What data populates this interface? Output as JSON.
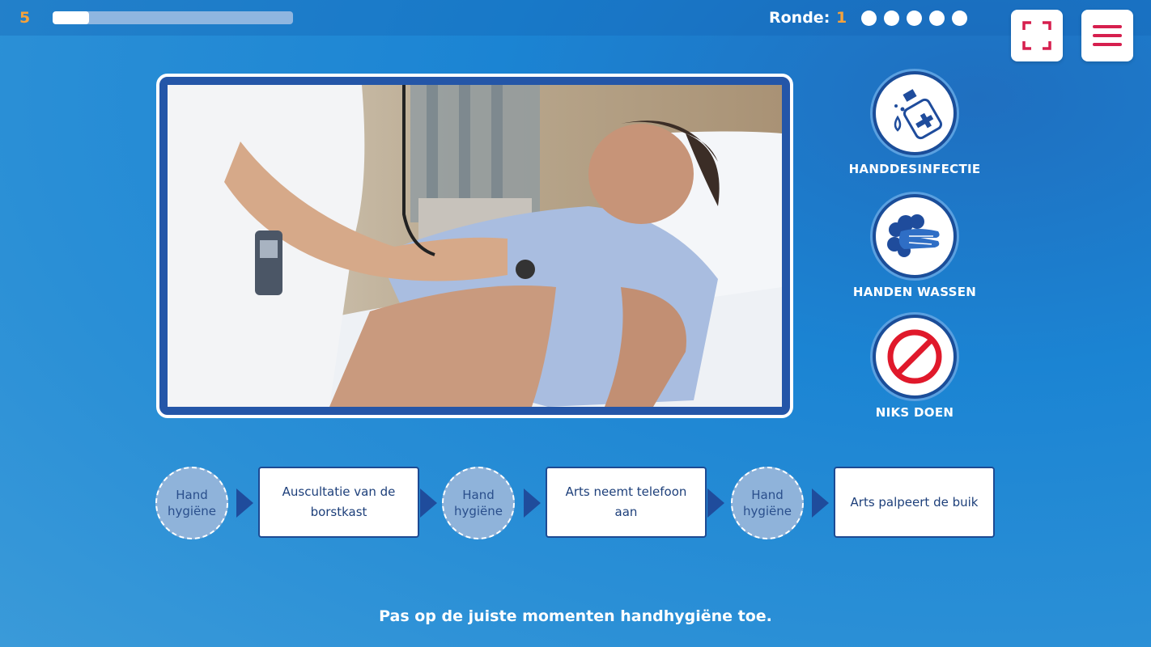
{
  "header": {
    "score": "5",
    "progress_fraction": 0.15,
    "round_label": "Ronde:",
    "round_number": "1",
    "round_dots": 5
  },
  "buttons": {
    "fullscreen_icon": "fullscreen-icon",
    "menu_icon": "hamburger-menu-icon"
  },
  "choices": [
    {
      "label": "HANDDESINFECTIE",
      "icon": "hand-sanitizer-icon"
    },
    {
      "label": "HANDEN WASSEN",
      "icon": "hand-washing-icon"
    },
    {
      "label": "NIKS DOEN",
      "icon": "prohibited-icon"
    }
  ],
  "sequence": [
    {
      "type": "slot",
      "text": "Hand hygiëne"
    },
    {
      "type": "step",
      "text": "Auscultatie van de borstkast"
    },
    {
      "type": "slot",
      "text": "Hand hygiëne"
    },
    {
      "type": "step",
      "text": "Arts neemt telefoon aan"
    },
    {
      "type": "slot",
      "text": "Hand hygiëne"
    },
    {
      "type": "step",
      "text": "Arts palpeert de buik"
    }
  ],
  "instruction": "Pas op de juiste momenten handhygiëne toe.",
  "colors": {
    "accent_orange": "#f5a23c",
    "menu_red": "#d61f4e",
    "frame_blue": "#2456a8"
  }
}
